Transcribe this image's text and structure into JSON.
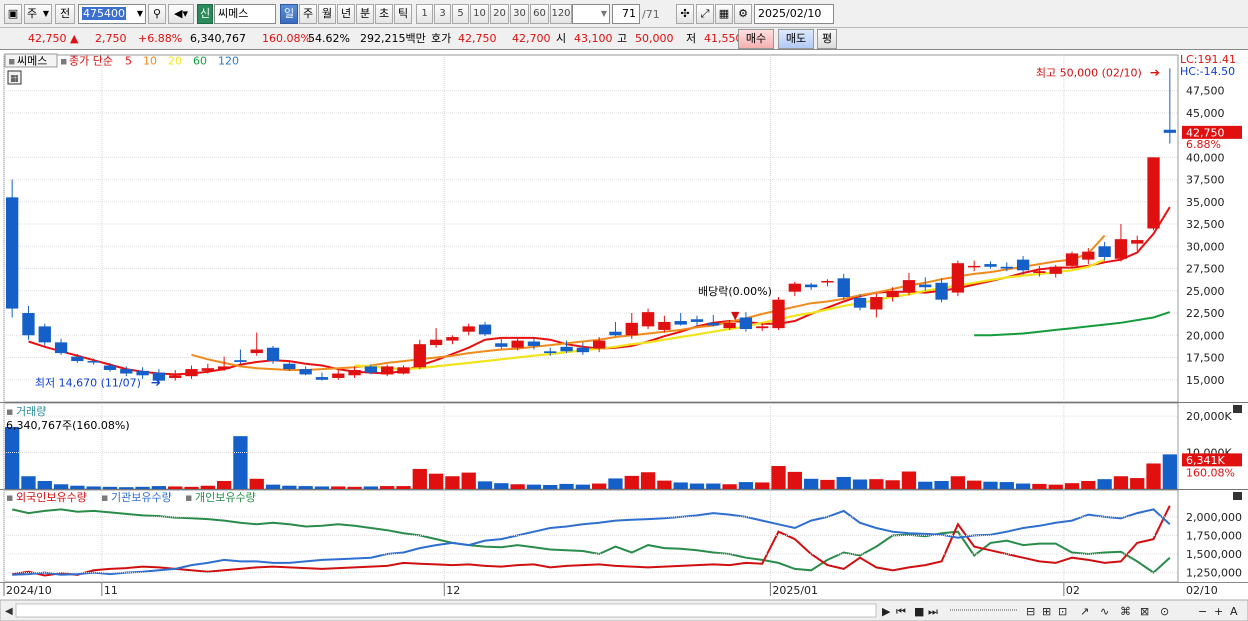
{
  "toolbar": {
    "type_select": "주",
    "prev_label": "전",
    "code": "475400",
    "market_badge": "신",
    "name": "씨메스",
    "periods": [
      "일",
      "주",
      "월",
      "년",
      "분",
      "초",
      "틱"
    ],
    "active_period": "일",
    "intervals": [
      "1",
      "3",
      "5",
      "10",
      "20",
      "30",
      "60",
      "120"
    ],
    "count": "71",
    "count_total": "/71",
    "date": "2025/02/10"
  },
  "quote": {
    "price": "42,750",
    "change": "2,750",
    "change_pct": "+6.88%",
    "volume": "6,340,767",
    "volume_ratio": "160.08%",
    "turnover_rate": "54.62%",
    "amount": "292,215백만",
    "ask_label": "호가",
    "ask": "42,750",
    "bid": "42,700",
    "open_label": "시",
    "open": "43,100",
    "high_label": "고",
    "high": "50,000",
    "low_label": "저",
    "low": "41,550",
    "buy_label": "매수",
    "sell_label": "매도",
    "eval_label": "평"
  },
  "price_panel": {
    "stock_tag": "씨메스",
    "legend_prefix": "종가 단순",
    "ma_labels": [
      {
        "label": "5",
        "color": "#e81010"
      },
      {
        "label": "10",
        "color": "#f08a1c"
      },
      {
        "label": "20",
        "color": "#f2e41c"
      },
      {
        "label": "60",
        "color": "#149c3c"
      },
      {
        "label": "120",
        "color": "#2a7ab8"
      }
    ],
    "lc_label": "LC:191.41",
    "hc_label": "HC:-14.50",
    "current_price_tag": "42,750",
    "current_pct_tag": "6.88%",
    "high_note": "최고 50,000 (02/10)",
    "low_note": "최저 14,670 (11/07)",
    "dividend_note": "배당락(0.00%)"
  },
  "volume_panel": {
    "title": "거래량",
    "info": "6,340,767주(160.08%)",
    "current_tag": "6,341K",
    "pct_tag": "160.08%"
  },
  "holdings_panel": {
    "labels": [
      {
        "label": "외국인보유수량",
        "color": "#d01010"
      },
      {
        "label": "기관보유수량",
        "color": "#2f6fd0"
      },
      {
        "label": "개인보유수량",
        "color": "#2a8c4a"
      }
    ]
  },
  "x_axis": {
    "labels": [
      {
        "label": "2024/10",
        "index": 0
      },
      {
        "label": "11",
        "index": 6
      },
      {
        "label": "12",
        "index": 27
      },
      {
        "label": "2025/01",
        "index": 47
      },
      {
        "label": "02",
        "index": 65
      }
    ],
    "right_label": "02/10"
  },
  "chart_data": {
    "type": "candlestick",
    "price_axis": {
      "ticks": [
        15000,
        17500,
        20000,
        22500,
        25000,
        27500,
        30000,
        32500,
        35000,
        37500,
        40000,
        45000,
        47500
      ],
      "ylim": [
        12500,
        51500
      ]
    },
    "volume_axis": {
      "ticks": [
        10000,
        20000
      ],
      "unit": "K"
    },
    "holdings_axis": {
      "ticks": [
        1250000,
        1500000,
        1750000,
        2000000
      ]
    },
    "candles": [
      {
        "o": 35500,
        "h": 37500,
        "l": 22000,
        "c": 23000
      },
      {
        "o": 22500,
        "h": 23300,
        "l": 19500,
        "c": 20000
      },
      {
        "o": 21000,
        "h": 21300,
        "l": 18800,
        "c": 19200
      },
      {
        "o": 19200,
        "h": 19600,
        "l": 17800,
        "c": 18000
      },
      {
        "o": 17600,
        "h": 17900,
        "l": 16900,
        "c": 17100
      },
      {
        "o": 17100,
        "h": 17400,
        "l": 16700,
        "c": 17000
      },
      {
        "o": 16600,
        "h": 16900,
        "l": 15900,
        "c": 16100
      },
      {
        "o": 16200,
        "h": 16500,
        "l": 15400,
        "c": 15700
      },
      {
        "o": 16000,
        "h": 16400,
        "l": 15100,
        "c": 15500
      },
      {
        "o": 15800,
        "h": 16200,
        "l": 14670,
        "c": 14900
      },
      {
        "o": 15200,
        "h": 16100,
        "l": 14900,
        "c": 15500
      },
      {
        "o": 15400,
        "h": 16600,
        "l": 15100,
        "c": 16200
      },
      {
        "o": 16000,
        "h": 16800,
        "l": 15700,
        "c": 16300
      },
      {
        "o": 16200,
        "h": 17600,
        "l": 16000,
        "c": 16500
      },
      {
        "o": 17200,
        "h": 18400,
        "l": 16800,
        "c": 17000
      },
      {
        "o": 18000,
        "h": 20300,
        "l": 17700,
        "c": 18400
      },
      {
        "o": 18600,
        "h": 18800,
        "l": 16800,
        "c": 17100
      },
      {
        "o": 16800,
        "h": 17000,
        "l": 16000,
        "c": 16200
      },
      {
        "o": 16200,
        "h": 16500,
        "l": 15500,
        "c": 15600
      },
      {
        "o": 15300,
        "h": 15800,
        "l": 14900,
        "c": 15000
      },
      {
        "o": 15200,
        "h": 16200,
        "l": 15000,
        "c": 15700
      },
      {
        "o": 15500,
        "h": 16500,
        "l": 15200,
        "c": 16100
      },
      {
        "o": 16500,
        "h": 16700,
        "l": 15600,
        "c": 15800
      },
      {
        "o": 15600,
        "h": 16700,
        "l": 15400,
        "c": 16500
      },
      {
        "o": 15700,
        "h": 16600,
        "l": 15600,
        "c": 16400
      },
      {
        "o": 16400,
        "h": 19500,
        "l": 16200,
        "c": 19000
      },
      {
        "o": 18900,
        "h": 20800,
        "l": 18600,
        "c": 19500
      },
      {
        "o": 19400,
        "h": 20000,
        "l": 19000,
        "c": 19800
      },
      {
        "o": 20400,
        "h": 21300,
        "l": 20000,
        "c": 21000
      },
      {
        "o": 21200,
        "h": 21500,
        "l": 19900,
        "c": 20100
      },
      {
        "o": 19100,
        "h": 19600,
        "l": 18500,
        "c": 18700
      },
      {
        "o": 18600,
        "h": 19700,
        "l": 18300,
        "c": 19400
      },
      {
        "o": 19300,
        "h": 19700,
        "l": 18400,
        "c": 18800
      },
      {
        "o": 18200,
        "h": 18600,
        "l": 17700,
        "c": 18000
      },
      {
        "o": 18700,
        "h": 19400,
        "l": 18000,
        "c": 18200
      },
      {
        "o": 18600,
        "h": 19200,
        "l": 17800,
        "c": 18100
      },
      {
        "o": 18500,
        "h": 19800,
        "l": 18100,
        "c": 19400
      },
      {
        "o": 20400,
        "h": 21500,
        "l": 19900,
        "c": 20000
      },
      {
        "o": 20000,
        "h": 22500,
        "l": 19600,
        "c": 21400
      },
      {
        "o": 21000,
        "h": 23000,
        "l": 20700,
        "c": 22600
      },
      {
        "o": 20600,
        "h": 22200,
        "l": 20300,
        "c": 21500
      },
      {
        "o": 21600,
        "h": 22500,
        "l": 21100,
        "c": 21200
      },
      {
        "o": 21800,
        "h": 22200,
        "l": 21000,
        "c": 21500
      },
      {
        "o": 21400,
        "h": 22300,
        "l": 21000,
        "c": 21100
      },
      {
        "o": 20800,
        "h": 21700,
        "l": 20600,
        "c": 21400
      },
      {
        "o": 22000,
        "h": 22600,
        "l": 20400,
        "c": 20700
      },
      {
        "o": 20800,
        "h": 21400,
        "l": 20500,
        "c": 21000
      },
      {
        "o": 20800,
        "h": 24300,
        "l": 20600,
        "c": 24000
      },
      {
        "o": 24900,
        "h": 26000,
        "l": 24400,
        "c": 25800
      },
      {
        "o": 25700,
        "h": 25900,
        "l": 25100,
        "c": 25400
      },
      {
        "o": 26000,
        "h": 26300,
        "l": 25500,
        "c": 26100
      },
      {
        "o": 26400,
        "h": 26900,
        "l": 24000,
        "c": 24300
      },
      {
        "o": 24200,
        "h": 24600,
        "l": 22800,
        "c": 23100
      },
      {
        "o": 22900,
        "h": 24700,
        "l": 22000,
        "c": 24300
      },
      {
        "o": 24300,
        "h": 25400,
        "l": 23800,
        "c": 24900
      },
      {
        "o": 24800,
        "h": 27000,
        "l": 24500,
        "c": 26200
      },
      {
        "o": 25700,
        "h": 26500,
        "l": 25000,
        "c": 25400
      },
      {
        "o": 25900,
        "h": 26400,
        "l": 23700,
        "c": 24000
      },
      {
        "o": 24800,
        "h": 28400,
        "l": 24400,
        "c": 28100
      },
      {
        "o": 27800,
        "h": 28400,
        "l": 27200,
        "c": 27800
      },
      {
        "o": 28000,
        "h": 28300,
        "l": 27500,
        "c": 27700
      },
      {
        "o": 27700,
        "h": 28200,
        "l": 27200,
        "c": 27500
      },
      {
        "o": 28500,
        "h": 28900,
        "l": 26800,
        "c": 27300
      },
      {
        "o": 27000,
        "h": 27800,
        "l": 26600,
        "c": 27200
      },
      {
        "o": 26900,
        "h": 27900,
        "l": 26500,
        "c": 27700
      },
      {
        "o": 27800,
        "h": 29400,
        "l": 27500,
        "c": 29200
      },
      {
        "o": 28500,
        "h": 29800,
        "l": 28000,
        "c": 29400
      },
      {
        "o": 30000,
        "h": 30500,
        "l": 28400,
        "c": 28800
      },
      {
        "o": 28600,
        "h": 32500,
        "l": 28300,
        "c": 30800
      },
      {
        "o": 30300,
        "h": 31200,
        "l": 29500,
        "c": 30700
      },
      {
        "o": 32000,
        "h": 40000,
        "l": 31800,
        "c": 40000
      },
      {
        "o": 43100,
        "h": 50000,
        "l": 41550,
        "c": 42750
      }
    ],
    "volume": [
      17000,
      3500,
      2200,
      1300,
      900,
      700,
      600,
      500,
      600,
      800,
      700,
      600,
      900,
      2200,
      14500,
      2800,
      1200,
      900,
      800,
      700,
      700,
      600,
      700,
      800,
      800,
      5500,
      4200,
      3500,
      4500,
      2100,
      1600,
      1300,
      1200,
      1100,
      1400,
      1200,
      1500,
      2900,
      3600,
      4600,
      2300,
      1800,
      1500,
      1500,
      1300,
      1900,
      1800,
      6300,
      4700,
      2800,
      2500,
      3300,
      2600,
      2700,
      2400,
      4800,
      2000,
      2200,
      3500,
      2300,
      2000,
      1900,
      1500,
      1400,
      1200,
      1600,
      2200,
      2700,
      3500,
      3000,
      7000,
      9500
    ],
    "ma": {
      "5": {
        "start": 1,
        "values": [
          19300,
          18700,
          18200,
          17700,
          17200,
          16700,
          16200,
          15900,
          15700,
          15600,
          15700,
          15900,
          16200,
          16700,
          17000,
          17200,
          17100,
          16800,
          16600,
          16200,
          15900,
          15800,
          15700,
          16000,
          16600,
          17200,
          17900,
          18600,
          19500,
          19700,
          19700,
          19700,
          19500,
          19000,
          18700,
          18500,
          18600,
          18800,
          19300,
          19900,
          20400,
          21000,
          21400,
          21600,
          21500,
          21300,
          21300,
          21600,
          22400,
          23100,
          23800,
          24400,
          24800,
          24900,
          24900,
          24800,
          25000,
          25300,
          25700,
          26100,
          26500,
          27000,
          27400,
          27600,
          27600,
          27800,
          28200,
          28500,
          29300,
          31400,
          34400
        ]
      },
      "10": {
        "start": 11,
        "values": [
          17800,
          17300,
          16900,
          16500,
          16300,
          16200,
          16100,
          16100,
          16200,
          16300,
          16400,
          16600,
          16900,
          17100,
          17300,
          17500,
          17700,
          18000,
          18200,
          18400,
          18500,
          18700,
          18900,
          19100,
          19300,
          19500,
          19800,
          20000,
          20200,
          20400,
          20600,
          20900,
          21100,
          21500,
          21900,
          22400,
          22800,
          23200,
          23600,
          23800,
          24100,
          24500,
          24800,
          25200,
          25600,
          25900,
          26300,
          26600,
          26900,
          27100,
          27400,
          27700,
          28000,
          28300,
          28500,
          29200,
          31200
        ]
      },
      "20": {
        "start": 21,
        "values": [
          16600,
          16500,
          16300,
          16200,
          16300,
          16500,
          16700,
          16900,
          17100,
          17300,
          17500,
          17700,
          17900,
          18100,
          18300,
          18500,
          18700,
          19000,
          19200,
          19500,
          19800,
          20100,
          20400,
          20700,
          21000,
          21400,
          21800,
          22200,
          22500,
          22900,
          23300,
          23600,
          24000,
          24300,
          24600,
          25000,
          25300,
          25600,
          25900,
          26200,
          26500,
          26700,
          26900,
          27100,
          27300,
          27700,
          28500
        ]
      },
      "60": {
        "start": 59,
        "values": [
          20000,
          20000,
          20100,
          20200,
          20400,
          20600,
          20800,
          21000,
          21200,
          21400,
          21700,
          22000,
          22600
        ]
      }
    },
    "holdings": {
      "foreign": [
        1230000,
        1260000,
        1210000,
        1240000,
        1220000,
        1280000,
        1300000,
        1310000,
        1330000,
        1320000,
        1300000,
        1280000,
        1260000,
        1280000,
        1300000,
        1320000,
        1330000,
        1320000,
        1310000,
        1300000,
        1310000,
        1320000,
        1330000,
        1340000,
        1380000,
        1370000,
        1360000,
        1350000,
        1360000,
        1340000,
        1330000,
        1350000,
        1360000,
        1320000,
        1340000,
        1350000,
        1360000,
        1340000,
        1330000,
        1320000,
        1330000,
        1340000,
        1350000,
        1360000,
        1350000,
        1380000,
        1370000,
        1800000,
        1700000,
        1500000,
        1350000,
        1300000,
        1450000,
        1320000,
        1280000,
        1320000,
        1350000,
        1400000,
        1900000,
        1600000,
        1550000,
        1500000,
        1450000,
        1400000,
        1380000,
        1450000,
        1420000,
        1380000,
        1400000,
        1650000,
        1700000,
        2150000
      ],
      "institution": [
        1220000,
        1230000,
        1250000,
        1220000,
        1230000,
        1250000,
        1230000,
        1250000,
        1260000,
        1280000,
        1300000,
        1350000,
        1380000,
        1420000,
        1400000,
        1400000,
        1380000,
        1380000,
        1400000,
        1420000,
        1430000,
        1440000,
        1450000,
        1500000,
        1520000,
        1580000,
        1620000,
        1650000,
        1620000,
        1680000,
        1700000,
        1750000,
        1800000,
        1850000,
        1870000,
        1900000,
        1920000,
        1950000,
        1960000,
        1970000,
        1980000,
        2000000,
        2020000,
        2050000,
        2030000,
        2000000,
        1950000,
        1900000,
        1850000,
        1950000,
        2000000,
        2080000,
        1920000,
        1850000,
        1800000,
        1780000,
        1770000,
        1760000,
        1720000,
        1750000,
        1760000,
        1800000,
        1850000,
        1880000,
        1920000,
        1950000,
        2030000,
        2000000,
        1980000,
        2050000,
        2100000,
        1900000
      ],
      "individual": [
        2100000,
        2050000,
        2080000,
        2100000,
        2070000,
        2080000,
        2060000,
        2040000,
        2020000,
        2010000,
        1990000,
        1980000,
        1970000,
        1950000,
        1920000,
        1900000,
        1920000,
        1900000,
        1870000,
        1880000,
        1900000,
        1880000,
        1850000,
        1820000,
        1780000,
        1750000,
        1700000,
        1650000,
        1620000,
        1600000,
        1590000,
        1620000,
        1590000,
        1560000,
        1550000,
        1540000,
        1500000,
        1600000,
        1520000,
        1620000,
        1580000,
        1570000,
        1550000,
        1520000,
        1500000,
        1450000,
        1420000,
        1380000,
        1300000,
        1280000,
        1420000,
        1520000,
        1480000,
        1600000,
        1750000,
        1760000,
        1740000,
        1780000,
        1800000,
        1480000,
        1650000,
        1680000,
        1620000,
        1640000,
        1640000,
        1520000,
        1500000,
        1520000,
        1530000,
        1400000,
        1250000,
        1450000
      ]
    }
  }
}
